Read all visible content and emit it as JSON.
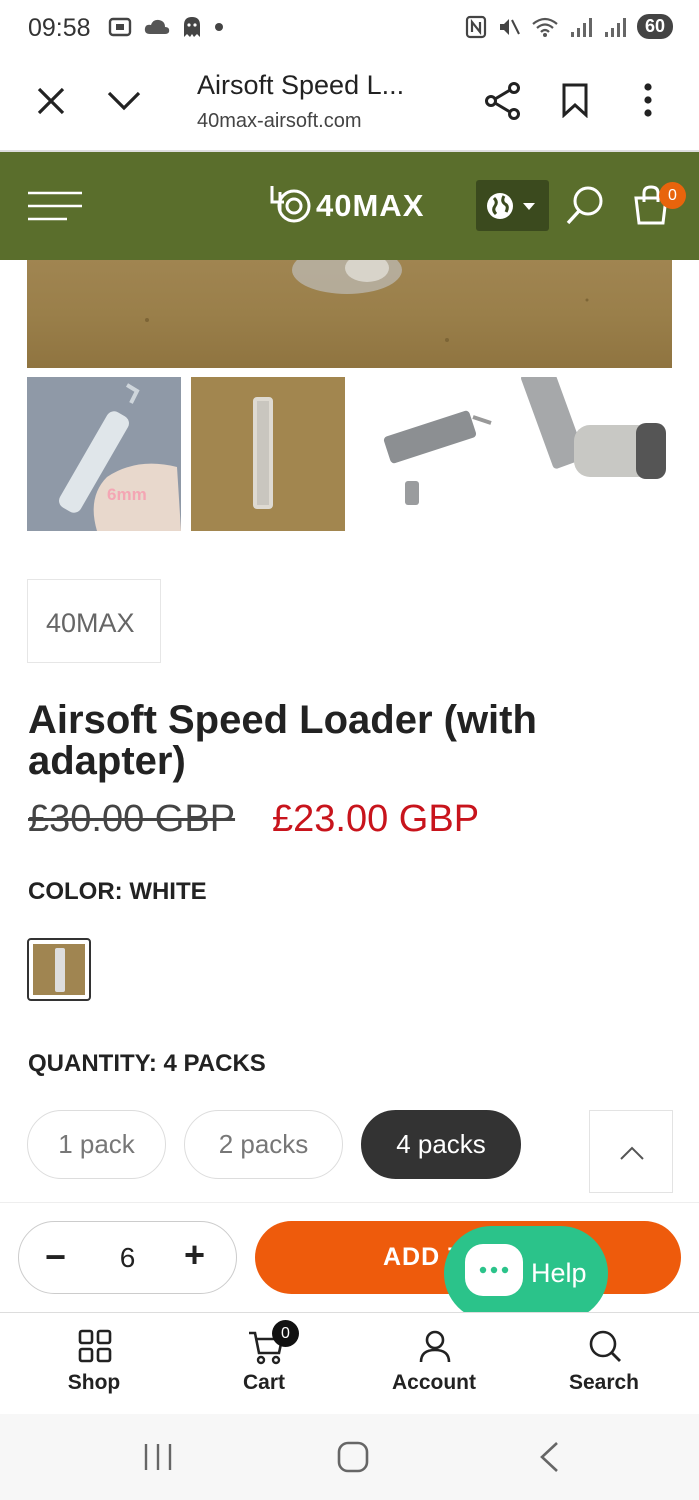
{
  "status_bar": {
    "time": "09:58",
    "battery": "60"
  },
  "browser": {
    "page_title": "Airsoft Speed L...",
    "url": "40max-airsoft.com"
  },
  "site_header": {
    "brand": "40MAX",
    "cart_count": "0",
    "header_color": "#5a6e2c"
  },
  "gallery": {
    "thumb_label": "6mm"
  },
  "product": {
    "vendor": "40MAX",
    "title": "Airsoft Speed Loader (with adapter)",
    "price_old": "£30.00 GBP",
    "price_new": "£23.00 GBP",
    "color_label": "COLOR: WHITE",
    "quantity_label": "QUANTITY: 4 PACKS",
    "pack_options": [
      "1 pack",
      "2 packs",
      "4 packs"
    ],
    "selected_pack": "4 packs"
  },
  "cart_bar": {
    "minus_label": "−",
    "quantity": "6",
    "plus_label": "+",
    "add_to_cart_label": "ADD T",
    "help_label": "Help",
    "accent_color": "#ee5b0c",
    "help_color": "#2bc38a"
  },
  "bottom_nav": {
    "items": [
      {
        "label": "Shop",
        "icon": "grid-icon"
      },
      {
        "label": "Cart",
        "icon": "cart-icon"
      },
      {
        "label": "Account",
        "icon": "account-icon"
      },
      {
        "label": "Search",
        "icon": "search-icon"
      }
    ],
    "cart_badge": "0"
  }
}
